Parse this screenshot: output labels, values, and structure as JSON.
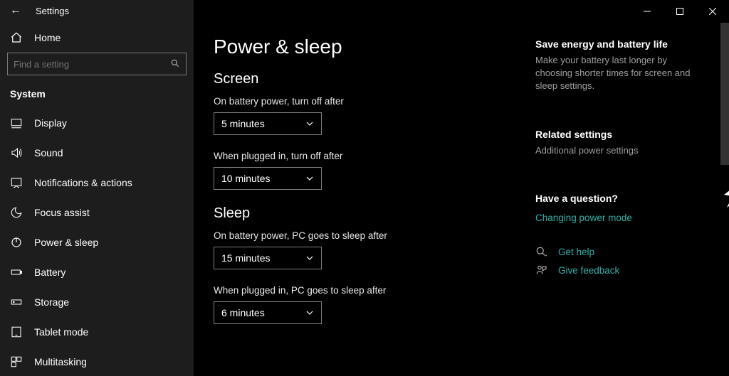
{
  "window": {
    "title": "Settings"
  },
  "sidebar": {
    "home": "Home",
    "search_placeholder": "Find a setting",
    "category": "System",
    "items": [
      {
        "label": "Display"
      },
      {
        "label": "Sound"
      },
      {
        "label": "Notifications & actions"
      },
      {
        "label": "Focus assist"
      },
      {
        "label": "Power & sleep"
      },
      {
        "label": "Battery"
      },
      {
        "label": "Storage"
      },
      {
        "label": "Tablet mode"
      },
      {
        "label": "Multitasking"
      }
    ]
  },
  "page": {
    "title": "Power & sleep",
    "screen": {
      "heading": "Screen",
      "battery_label": "On battery power, turn off after",
      "battery_value": "5 minutes",
      "plugged_label": "When plugged in, turn off after",
      "plugged_value": "10 minutes"
    },
    "sleep": {
      "heading": "Sleep",
      "battery_label": "On battery power, PC goes to sleep after",
      "battery_value": "15 minutes",
      "plugged_label": "When plugged in, PC goes to sleep after",
      "plugged_value": "6 minutes"
    }
  },
  "aside": {
    "energy_heading": "Save energy and battery life",
    "energy_text": "Make your battery last longer by choosing shorter times for screen and sleep settings.",
    "related_heading": "Related settings",
    "related_link": "Additional power settings",
    "question_heading": "Have a question?",
    "question_link": "Changing power mode",
    "help_link": "Get help",
    "feedback_link": "Give feedback"
  }
}
